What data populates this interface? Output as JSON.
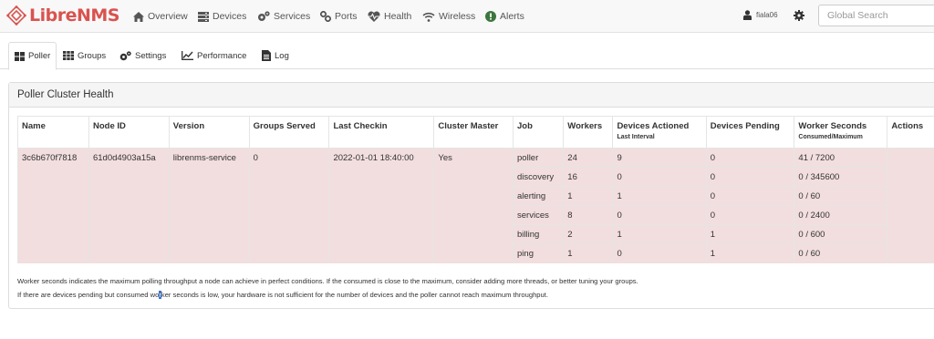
{
  "brand": {
    "name": "LibreNMS",
    "color": "#d9534f"
  },
  "nav": [
    {
      "label": "Overview",
      "icon": "home-icon"
    },
    {
      "label": "Devices",
      "icon": "server-icon"
    },
    {
      "label": "Services",
      "icon": "cogs-icon"
    },
    {
      "label": "Ports",
      "icon": "link-icon"
    },
    {
      "label": "Health",
      "icon": "heartbeat-icon"
    },
    {
      "label": "Wireless",
      "icon": "wifi-icon"
    },
    {
      "label": "Alerts",
      "icon": "exclamation-circle-icon"
    }
  ],
  "user": {
    "name": "fiala06"
  },
  "search": {
    "placeholder": "Global Search"
  },
  "tabs": [
    {
      "label": "Poller",
      "icon": "th-large-icon",
      "active": true
    },
    {
      "label": "Groups",
      "icon": "th-icon",
      "active": false
    },
    {
      "label": "Settings",
      "icon": "cogs-icon",
      "active": false
    },
    {
      "label": "Performance",
      "icon": "line-chart-icon",
      "active": false
    },
    {
      "label": "Log",
      "icon": "file-text-icon",
      "active": false
    }
  ],
  "panel": {
    "title": "Poller Cluster Health"
  },
  "table": {
    "headers": {
      "name": "Name",
      "node_id": "Node ID",
      "version": "Version",
      "groups_served": "Groups Served",
      "last_checkin": "Last Checkin",
      "cluster_master": "Cluster Master",
      "job": "Job",
      "workers": "Workers",
      "devices_actioned": "Devices Actioned",
      "devices_actioned_sub": "Last Interval",
      "devices_pending": "Devices Pending",
      "worker_seconds": "Worker Seconds",
      "worker_seconds_sub": "Consumed/Maximum",
      "actions": "Actions"
    },
    "node": {
      "name": "3c6b670f7818",
      "node_id": "61d0d4903a15a",
      "version": "librenms-service",
      "groups_served": "0",
      "last_checkin": "2022-01-01 18:40:00",
      "cluster_master": "Yes"
    },
    "jobs": [
      {
        "job": "poller",
        "workers": "24",
        "devices_actioned": "9",
        "devices_pending": "0",
        "worker_seconds": "41 / 7200"
      },
      {
        "job": "discovery",
        "workers": "16",
        "devices_actioned": "0",
        "devices_pending": "0",
        "worker_seconds": "0 / 345600"
      },
      {
        "job": "alerting",
        "workers": "1",
        "devices_actioned": "1",
        "devices_pending": "0",
        "worker_seconds": "0 / 60"
      },
      {
        "job": "services",
        "workers": "8",
        "devices_actioned": "0",
        "devices_pending": "0",
        "worker_seconds": "0 / 2400"
      },
      {
        "job": "billing",
        "workers": "2",
        "devices_actioned": "1",
        "devices_pending": "1",
        "worker_seconds": "0 / 600"
      },
      {
        "job": "ping",
        "workers": "1",
        "devices_actioned": "0",
        "devices_pending": "1",
        "worker_seconds": "0 / 60"
      }
    ]
  },
  "notes": {
    "line1": "Worker seconds indicates the maximum polling throughput a node can achieve in perfect conditions. If the consumed is close to the maximum, consider adding more threads, or better tuning your groups.",
    "line2_a": "If there are devices pending but consumed wo",
    "line2_b": "r",
    "line2_c": "ker seconds is low, your hardware is not sufficient for the number of devices and the poller cannot reach maximum throughput."
  }
}
